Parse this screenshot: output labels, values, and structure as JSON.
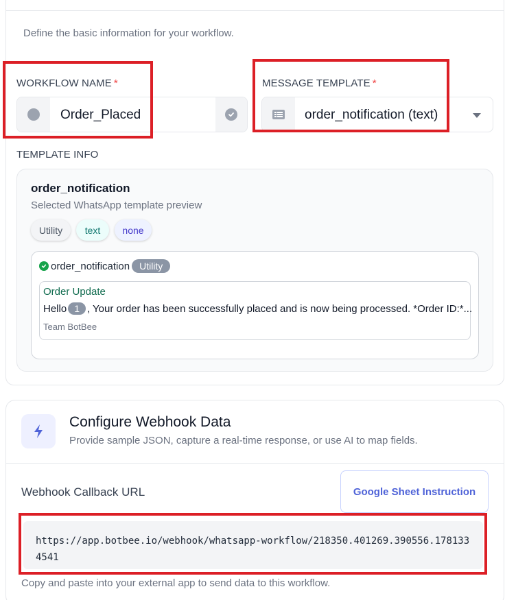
{
  "basic_info": {
    "subtitle": "Define the basic information for your workflow.",
    "workflow_name": {
      "label": "WORKFLOW NAME",
      "required_mark": "*",
      "value": "Order_Placed",
      "left_icon": "circle-icon",
      "right_icon": "check-circle-icon"
    },
    "message_template": {
      "label": "MESSAGE TEMPLATE",
      "required_mark": "*",
      "selected": "order_notification (text)",
      "left_icon": "template-list-icon",
      "dropdown_icon": "chevron-down-icon"
    },
    "template_info": {
      "label": "TEMPLATE INFO",
      "name": "order_notification",
      "description": "Selected WhatsApp template preview",
      "chips": [
        "Utility",
        "text",
        "none"
      ],
      "preview": {
        "name": "order_notification",
        "category_badge": "Utility",
        "header": "Order Update",
        "body_prefix": "Hello",
        "variable": "1",
        "body_suffix": ", Your order has been successfully placed and is now being processed. *Order ID:*...",
        "footer": "Team BotBee"
      }
    }
  },
  "webhook": {
    "title": "Configure Webhook Data",
    "subtitle": "Provide sample JSON, capture a real-time response, or use AI to map fields.",
    "icon": "bolt-icon",
    "callback_label": "Webhook Callback URL",
    "instruction_button": "Google Sheet Instruction",
    "url": "https://app.botbee.io/webhook/whatsapp-workflow/218350.401269.390556.1781334541",
    "hint": "Copy and paste into your external app to send data to this workflow."
  },
  "colors": {
    "annotation_red": "#dc1f26",
    "accent_indigo": "#4f63d8",
    "success_green": "#16a34a",
    "required_red": "#ef4444"
  }
}
